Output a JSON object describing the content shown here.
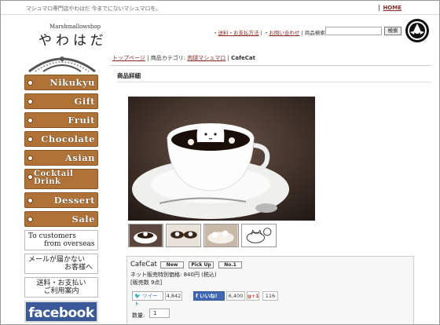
{
  "header": {
    "tagline": "マシュマロ専門店やわはだ 今までにないマシュマロを。",
    "home_label": "HOME",
    "logo_sub": "Marshmallowshop",
    "logo_main": "やわはだ",
    "nav_shipping": "送料・お支払方法",
    "nav_contact": "お問い合わせ",
    "search_label": "商品検索:",
    "search_button": "検索"
  },
  "sidebar": {
    "categories": [
      "Nikukyu",
      "Gift",
      "Fruit",
      "Chocolate",
      "Asian",
      "Cocktail Drink",
      "Dessert",
      "Sale"
    ],
    "overseas_line1": "To customers",
    "overseas_line2": "from overseas",
    "mail_line1": "メールが届かない",
    "mail_line2": "お客様へ",
    "guide_line1": "送料・お支払い",
    "guide_line2": "ご利用案内",
    "facebook_label": "facebook"
  },
  "breadcrumb": {
    "top": "トップページ",
    "category_label": "商品カテゴリ:",
    "category": "肉球マシュマロ",
    "current": "CafeCat"
  },
  "section_title": "商品詳細",
  "product": {
    "name": "CafeCat",
    "badges": [
      "New",
      "Pick Up",
      "No.1"
    ],
    "price_text": "ネット販売特別価格: 840円 (税込)",
    "stock_text": "[販売数 9点]",
    "tweet_label": "ツイート",
    "tweet_count": "4,842",
    "like_label": "いいね!",
    "like_count": "6,400",
    "gplus_label": "g+1",
    "gplus_count": "116",
    "qty_label": "数量:",
    "qty_value": "1"
  },
  "colors": {
    "tag_brown": "#b07236",
    "link": "#8a2a2a",
    "facebook": "#3b5998"
  }
}
